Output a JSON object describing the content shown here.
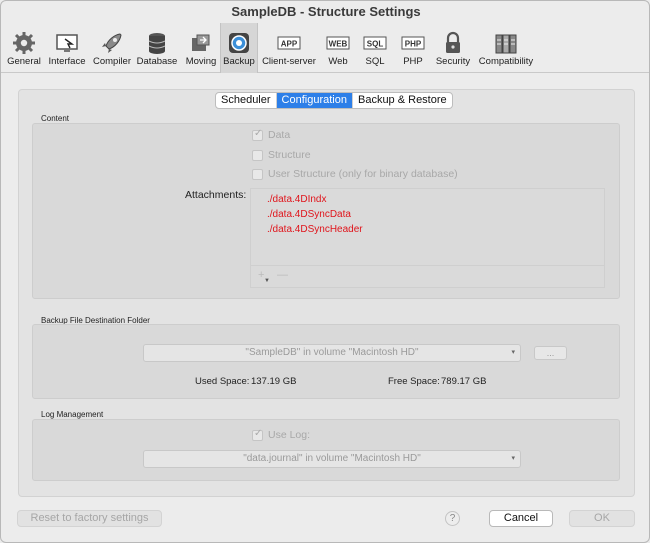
{
  "window": {
    "title": "SampleDB - Structure Settings"
  },
  "toolbar": {
    "items": [
      {
        "label": "General",
        "icon": "gear-icon"
      },
      {
        "label": "Interface",
        "icon": "interface-icon"
      },
      {
        "label": "Compiler",
        "icon": "rocket-icon"
      },
      {
        "label": "Database",
        "icon": "database-icon"
      },
      {
        "label": "Moving",
        "icon": "moving-icon"
      },
      {
        "label": "Backup",
        "icon": "backup-icon"
      },
      {
        "label": "Client-server",
        "icon": "app-icon"
      },
      {
        "label": "Web",
        "icon": "web-icon"
      },
      {
        "label": "SQL",
        "icon": "sql-icon"
      },
      {
        "label": "PHP",
        "icon": "php-icon"
      },
      {
        "label": "Security",
        "icon": "lock-icon"
      },
      {
        "label": "Compatibility",
        "icon": "compatibility-icon"
      }
    ],
    "active": "Backup"
  },
  "tabs": {
    "scheduler": "Scheduler",
    "configuration": "Configuration",
    "backup_restore": "Backup & Restore",
    "selected": "Configuration"
  },
  "content_section": {
    "title": "Content",
    "data_label": "Data",
    "structure_label": "Structure",
    "user_structure_label": "User Structure (only for binary database)",
    "attachments_label": "Attachments:",
    "attachments": [
      "./data.4DIndx",
      "./data.4DSyncData",
      "./data.4DSyncHeader"
    ],
    "add_symbol": "+",
    "remove_symbol": "—"
  },
  "destination_section": {
    "title": "Backup File Destination Folder",
    "folder_value": "\"SampleDB\" in volume \"Macintosh HD\"",
    "browse_label": "...",
    "used_space_label": "Used Space:",
    "used_space_value": "137.19 GB",
    "free_space_label": "Free Space:",
    "free_space_value": "789.17 GB"
  },
  "log_section": {
    "title": "Log Management",
    "use_log_label": "Use Log:",
    "log_file_value": "\"data.journal\" in volume \"Macintosh HD\""
  },
  "footer": {
    "reset_label": "Reset to factory settings",
    "help_label": "?",
    "cancel_label": "Cancel",
    "ok_label": "OK"
  }
}
